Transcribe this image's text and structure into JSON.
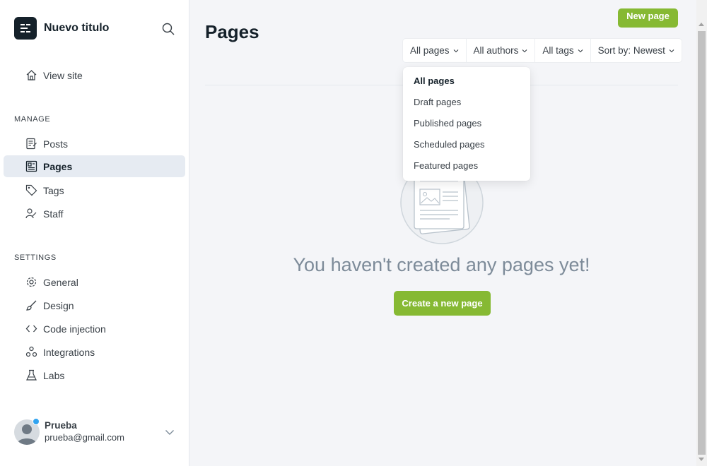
{
  "app": {
    "title": "Nuevo titulo",
    "view_site": "View site"
  },
  "sidebar": {
    "manage_title": "MANAGE",
    "manage_items": [
      {
        "label": "Posts",
        "icon": "posts-icon"
      },
      {
        "label": "Pages",
        "icon": "pages-icon",
        "active": true
      },
      {
        "label": "Tags",
        "icon": "tag-icon"
      },
      {
        "label": "Staff",
        "icon": "staff-icon"
      }
    ],
    "settings_title": "SETTINGS",
    "settings_items": [
      {
        "label": "General",
        "icon": "gear-icon"
      },
      {
        "label": "Design",
        "icon": "brush-icon"
      },
      {
        "label": "Code injection",
        "icon": "code-icon"
      },
      {
        "label": "Integrations",
        "icon": "integrations-icon"
      },
      {
        "label": "Labs",
        "icon": "flask-icon"
      }
    ]
  },
  "user": {
    "name": "Prueba",
    "email": "prueba@gmail.com"
  },
  "main": {
    "title": "Pages",
    "new_button": "New page",
    "filters": {
      "pages": "All pages",
      "authors": "All authors",
      "tags": "All tags",
      "sort": "Sort by: Newest"
    },
    "dropdown": [
      {
        "label": "All pages",
        "selected": true
      },
      {
        "label": "Draft pages"
      },
      {
        "label": "Published pages"
      },
      {
        "label": "Scheduled pages"
      },
      {
        "label": "Featured pages"
      }
    ],
    "empty_message": "You haven't created any pages yet!",
    "create_button": "Create a new page"
  },
  "colors": {
    "accent_green": "#86b933",
    "active_bg": "#e6ebf2",
    "status_dot": "#30a3f0"
  }
}
